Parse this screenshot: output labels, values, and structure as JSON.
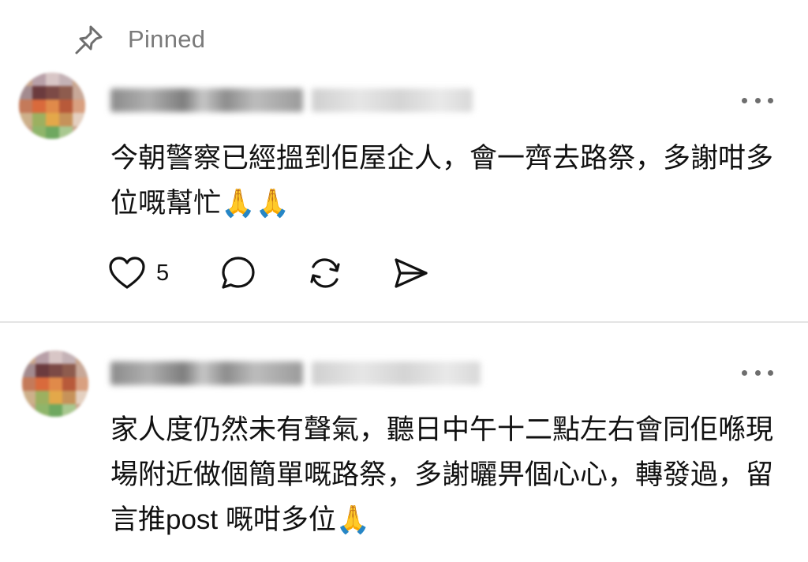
{
  "pinned": {
    "label": "Pinned",
    "icon": "pin-icon"
  },
  "comments": [
    {
      "text": "今朝警察已經搵到佢屋企人，會一齊去路祭，多謝咁多位嘅幫忙🙏🙏",
      "more_icon": "more-horizontal-icon",
      "actions": {
        "like_count": "5",
        "icons": [
          "heart-icon",
          "comment-icon",
          "repost-icon",
          "share-icon"
        ]
      }
    },
    {
      "text": "家人度仍然未有聲氣，聽日中午十二點左右會同佢喺現場附近做個簡單嘅路祭，多謝曬畀個心心，轉發過，留言推post 嘅咁多位🙏",
      "more_icon": "more-horizontal-icon"
    }
  ],
  "colors": {
    "muted": "#7a7a7a",
    "divider": "#e4e4e4",
    "text": "#111111"
  }
}
